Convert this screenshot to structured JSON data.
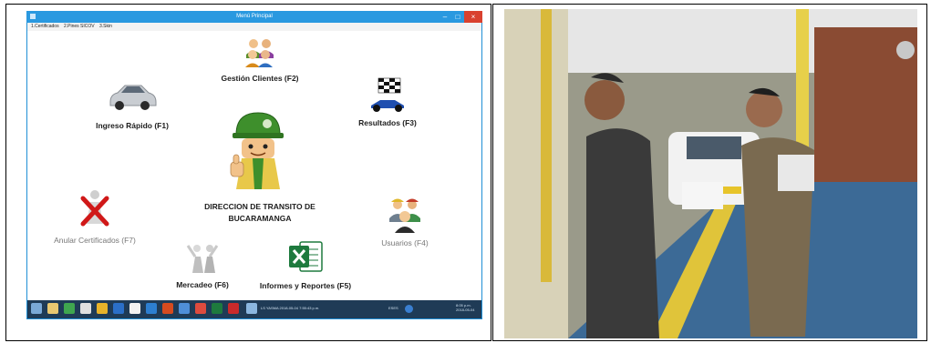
{
  "window": {
    "title": "Menú Principal",
    "controls": {
      "minimize": "–",
      "maximize": "□",
      "close": "×"
    }
  },
  "menu": [
    "1.Certificados",
    "2.Pines SICOV",
    "3.Skin"
  ],
  "modules": {
    "gestion": "Gestión Clientes (F2)",
    "ingreso": "Ingreso Rápido (F1)",
    "resultados": "Resultados  (F3)",
    "center_title_1": "DIRECCION DE TRANSITO DE",
    "center_title_2": "BUCARAMANGA",
    "anular": "Anular Certificados (F7)",
    "usuarios": "Usuarios (F4)",
    "mercadeo": "Mercadeo (F6)",
    "informes": "Informes y Reportes  (F5)"
  },
  "taskbar": {
    "task_label": "LS YASMA 2018-05-04 7:55:43 p.m.",
    "tray_label": "ESES",
    "clock_time": "8:05 p.m.",
    "clock_date": "2018-05-04"
  },
  "colors": {
    "window_chrome": "#1f8fd6",
    "close_button": "#d9412f",
    "taskbar": "#1f3b56",
    "excel_green": "#1e7a3e",
    "helmet_green": "#3e8f2c"
  }
}
